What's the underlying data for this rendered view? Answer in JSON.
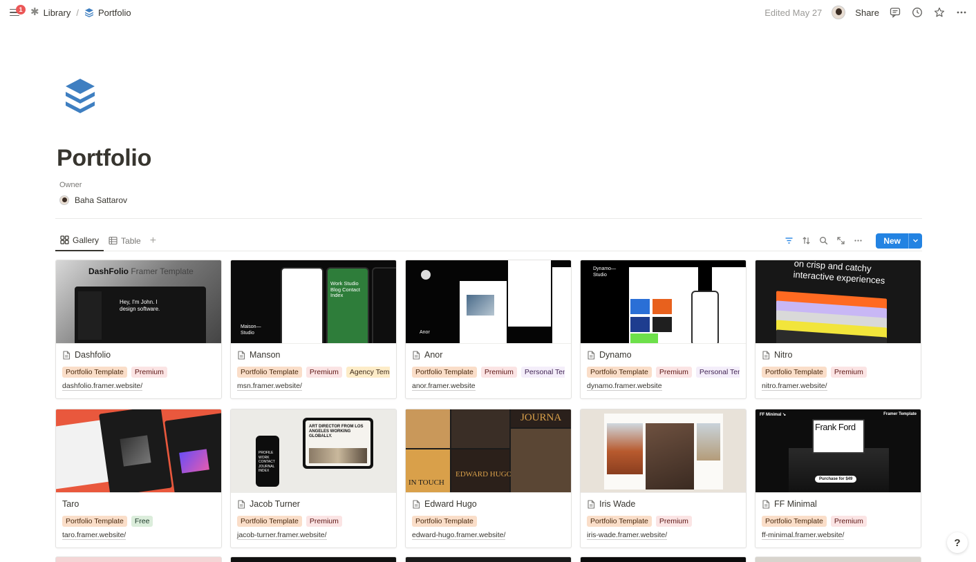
{
  "topbar": {
    "notifications": "1",
    "breadcrumb": [
      {
        "label": "Library",
        "icon": "asterisk-icon"
      },
      {
        "label": "Portfolio",
        "icon": "stack-icon"
      }
    ],
    "edited": "Edited May 27",
    "share": "Share"
  },
  "page": {
    "title": "Portfolio",
    "owner_label": "Owner",
    "owner_name": "Baha Sattarov",
    "icon_color": "#3f7fc1"
  },
  "views": {
    "tabs": [
      "Gallery",
      "Table"
    ],
    "active": "Gallery",
    "new_label": "New"
  },
  "cover_text": {
    "dashfolio_title_bold": "DashFolio",
    "dashfolio_title_rest": " Framer Template",
    "dashfolio_hero": "Hey, I'm John. I design software.",
    "manson_brand": "Maison— Studio",
    "manson_nav": "Work Studio Blog Contact Index",
    "nitro_headline": "on crisp and catchy interactive experiences",
    "jt_headline": "ART DIRECTOR FROM LOS ANGELES WORKING GLOBALLY.",
    "jt_phone_menu": "PROFILE WORK CONTACT JOURNAL INDEX",
    "eh_journal": "JOURNA",
    "eh_name": "EDWARD HUGO",
    "eh_touch": "IN TOUCH",
    "ff_tag_left": "FF Minimal ↘",
    "ff_tag_right": "Framer Template",
    "ff_name": "Frank Ford",
    "ff_cta": "Purchase for $49",
    "dynamo_brand": "Dynamo— Studio",
    "anor_brand": "Anor"
  },
  "cards": [
    {
      "title": "Dashfolio",
      "has_icon": true,
      "tags": [
        "Portfolio Template",
        "Premium"
      ],
      "url": "dashfolio.framer.website/"
    },
    {
      "title": "Manson",
      "has_icon": true,
      "tags": [
        "Portfolio Template",
        "Premium",
        "Agency Template"
      ],
      "url": "msn.framer.website/"
    },
    {
      "title": "Anor",
      "has_icon": true,
      "tags": [
        "Portfolio Template",
        "Premium",
        "Personal Template"
      ],
      "url": "anor.framer.website"
    },
    {
      "title": "Dynamo",
      "has_icon": true,
      "tags": [
        "Portfolio Template",
        "Premium",
        "Personal Template"
      ],
      "url": "dynamo.framer.website"
    },
    {
      "title": "Nitro",
      "has_icon": true,
      "tags": [
        "Portfolio Template",
        "Premium"
      ],
      "url": "nitro.framer.website/"
    },
    {
      "title": "Taro",
      "has_icon": false,
      "tags": [
        "Portfolio Template",
        "Free"
      ],
      "url": "taro.framer.website/"
    },
    {
      "title": "Jacob Turner",
      "has_icon": true,
      "tags": [
        "Portfolio Template",
        "Premium"
      ],
      "url": "jacob-turner.framer.website/"
    },
    {
      "title": "Edward Hugo",
      "has_icon": true,
      "tags": [
        "Portfolio Template"
      ],
      "url": "edward-hugo.framer.website/"
    },
    {
      "title": "Iris Wade",
      "has_icon": true,
      "tags": [
        "Portfolio Template",
        "Premium"
      ],
      "url": "iris-wade.framer.website/"
    },
    {
      "title": "FF Minimal",
      "has_icon": true,
      "tags": [
        "Portfolio Template",
        "Premium"
      ],
      "url": "ff-minimal.framer.website/"
    }
  ],
  "tag_colors": {
    "Portfolio Template": {
      "bg": "#fadec9",
      "fg": "#49290e"
    },
    "Premium": {
      "bg": "#fbe4e4",
      "fg": "#5d1715"
    },
    "Agency Template": {
      "bg": "#fdecc8",
      "fg": "#402c1b"
    },
    "Personal Template": {
      "bg": "#f4eefa",
      "fg": "#412454"
    },
    "Free": {
      "bg": "#dbeddb",
      "fg": "#1c3829"
    }
  },
  "help": "?"
}
